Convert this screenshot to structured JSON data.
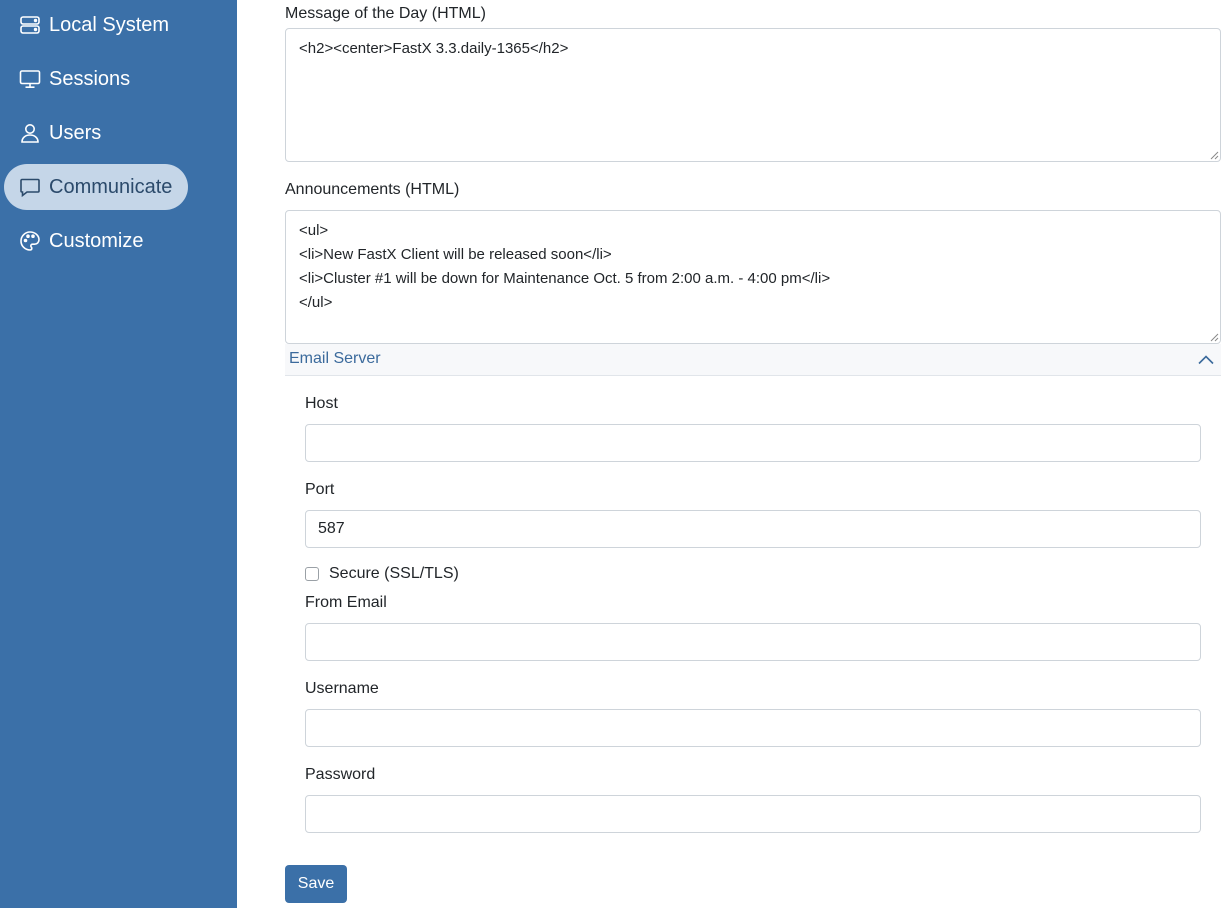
{
  "sidebar": {
    "items": [
      {
        "label": "Local System",
        "icon": "server-icon",
        "active": false
      },
      {
        "label": "Sessions",
        "icon": "monitor-icon",
        "active": false
      },
      {
        "label": "Users",
        "icon": "user-icon",
        "active": false
      },
      {
        "label": "Communicate",
        "icon": "chat-icon",
        "active": true
      },
      {
        "label": "Customize",
        "icon": "palette-icon",
        "active": false
      }
    ]
  },
  "colors": {
    "sidebar_bg": "#3b70a8",
    "active_item_bg": "#c5d6e8",
    "section_title": "#3b6a9c",
    "button_bg": "#3b70a8"
  },
  "motd": {
    "label": "Message of the Day (HTML)",
    "value": "<h2><center>FastX 3.3.daily-1365</h2>"
  },
  "announcements": {
    "label": "Announcements (HTML)",
    "value": "<ul>\n<li>New FastX Client will be released soon</li>\n<li>Cluster #1 will be down for Maintenance Oct. 5 from 2:00 a.m. - 4:00 pm</li>\n</ul>"
  },
  "email_server": {
    "title": "Email Server",
    "host": {
      "label": "Host",
      "value": ""
    },
    "port": {
      "label": "Port",
      "value": "587"
    },
    "secure": {
      "label": "Secure (SSL/TLS)",
      "checked": false
    },
    "from_email": {
      "label": "From Email",
      "value": ""
    },
    "username": {
      "label": "Username",
      "value": ""
    },
    "password": {
      "label": "Password",
      "value": ""
    }
  },
  "save_label": "Save"
}
